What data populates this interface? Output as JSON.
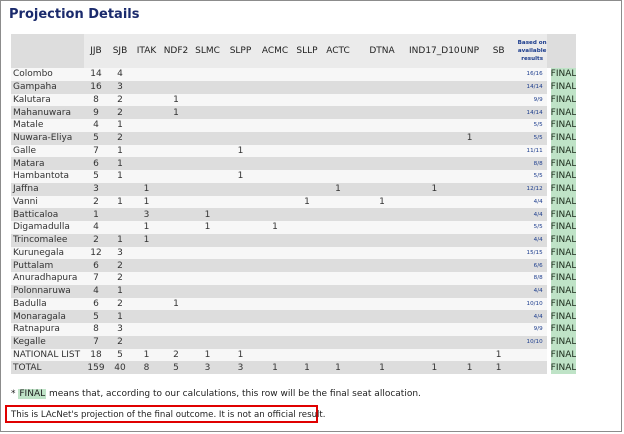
{
  "title": "Projection Details",
  "columns": [
    "JJB",
    "SJB",
    "ITAK",
    "NDF2",
    "SLMC",
    "SLPP",
    "ACMC",
    "SLLP",
    "ACTC",
    "DTNA",
    "IND17_D10",
    "UNP",
    "SB"
  ],
  "based_header": "Based on available results",
  "final_label": "FINAL",
  "rows": [
    {
      "name": "Colombo",
      "cells": [
        "14",
        "4",
        "",
        "",
        "",
        "",
        "",
        "",
        "",
        "",
        "",
        "",
        ""
      ],
      "based": "16/16"
    },
    {
      "name": "Gampaha",
      "cells": [
        "16",
        "3",
        "",
        "",
        "",
        "",
        "",
        "",
        "",
        "",
        "",
        "",
        ""
      ],
      "based": "14/14"
    },
    {
      "name": "Kalutara",
      "cells": [
        "8",
        "2",
        "",
        "1",
        "",
        "",
        "",
        "",
        "",
        "",
        "",
        "",
        ""
      ],
      "based": "9/9"
    },
    {
      "name": "Mahanuwara",
      "cells": [
        "9",
        "2",
        "",
        "1",
        "",
        "",
        "",
        "",
        "",
        "",
        "",
        "",
        ""
      ],
      "based": "14/14"
    },
    {
      "name": "Matale",
      "cells": [
        "4",
        "1",
        "",
        "",
        "",
        "",
        "",
        "",
        "",
        "",
        "",
        "",
        ""
      ],
      "based": "5/5"
    },
    {
      "name": "Nuwara-Eliya",
      "cells": [
        "5",
        "2",
        "",
        "",
        "",
        "",
        "",
        "",
        "",
        "",
        "",
        "1",
        ""
      ],
      "based": "5/5"
    },
    {
      "name": "Galle",
      "cells": [
        "7",
        "1",
        "",
        "",
        "",
        "1",
        "",
        "",
        "",
        "",
        "",
        "",
        ""
      ],
      "based": "11/11"
    },
    {
      "name": "Matara",
      "cells": [
        "6",
        "1",
        "",
        "",
        "",
        "",
        "",
        "",
        "",
        "",
        "",
        "",
        ""
      ],
      "based": "8/8"
    },
    {
      "name": "Hambantota",
      "cells": [
        "5",
        "1",
        "",
        "",
        "",
        "1",
        "",
        "",
        "",
        "",
        "",
        "",
        ""
      ],
      "based": "5/5"
    },
    {
      "name": "Jaffna",
      "cells": [
        "3",
        "",
        "1",
        "",
        "",
        "",
        "",
        "",
        "1",
        "",
        "1",
        "",
        ""
      ],
      "based": "12/12"
    },
    {
      "name": "Vanni",
      "cells": [
        "2",
        "1",
        "1",
        "",
        "",
        "",
        "",
        "1",
        "",
        "1",
        "",
        "",
        ""
      ],
      "based": "4/4"
    },
    {
      "name": "Batticaloa",
      "cells": [
        "1",
        "",
        "3",
        "",
        "1",
        "",
        "",
        "",
        "",
        "",
        "",
        "",
        ""
      ],
      "based": "4/4"
    },
    {
      "name": "Digamadulla",
      "cells": [
        "4",
        "",
        "1",
        "",
        "1",
        "",
        "1",
        "",
        "",
        "",
        "",
        "",
        ""
      ],
      "based": "5/5"
    },
    {
      "name": "Trincomalee",
      "cells": [
        "2",
        "1",
        "1",
        "",
        "",
        "",
        "",
        "",
        "",
        "",
        "",
        "",
        ""
      ],
      "based": "4/4"
    },
    {
      "name": "Kurunegala",
      "cells": [
        "12",
        "3",
        "",
        "",
        "",
        "",
        "",
        "",
        "",
        "",
        "",
        "",
        ""
      ],
      "based": "15/15"
    },
    {
      "name": "Puttalam",
      "cells": [
        "6",
        "2",
        "",
        "",
        "",
        "",
        "",
        "",
        "",
        "",
        "",
        "",
        ""
      ],
      "based": "6/6"
    },
    {
      "name": "Anuradhapura",
      "cells": [
        "7",
        "2",
        "",
        "",
        "",
        "",
        "",
        "",
        "",
        "",
        "",
        "",
        ""
      ],
      "based": "8/8"
    },
    {
      "name": "Polonnaruwa",
      "cells": [
        "4",
        "1",
        "",
        "",
        "",
        "",
        "",
        "",
        "",
        "",
        "",
        "",
        ""
      ],
      "based": "4/4"
    },
    {
      "name": "Badulla",
      "cells": [
        "6",
        "2",
        "",
        "1",
        "",
        "",
        "",
        "",
        "",
        "",
        "",
        "",
        ""
      ],
      "based": "10/10"
    },
    {
      "name": "Monaragala",
      "cells": [
        "5",
        "1",
        "",
        "",
        "",
        "",
        "",
        "",
        "",
        "",
        "",
        "",
        ""
      ],
      "based": "4/4"
    },
    {
      "name": "Ratnapura",
      "cells": [
        "8",
        "3",
        "",
        "",
        "",
        "",
        "",
        "",
        "",
        "",
        "",
        "",
        ""
      ],
      "based": "9/9"
    },
    {
      "name": "Kegalle",
      "cells": [
        "7",
        "2",
        "",
        "",
        "",
        "",
        "",
        "",
        "",
        "",
        "",
        "",
        ""
      ],
      "based": "10/10"
    },
    {
      "name": "NATIONAL LIST",
      "cells": [
        "18",
        "5",
        "1",
        "2",
        "1",
        "1",
        "",
        "",
        "",
        "",
        "",
        "",
        "1"
      ],
      "based": ""
    },
    {
      "name": "TOTAL",
      "cells": [
        "159",
        "40",
        "8",
        "5",
        "3",
        "3",
        "1",
        "1",
        "1",
        "1",
        "1",
        "1",
        "1"
      ],
      "based": ""
    }
  ],
  "footnote": {
    "prefix": "* ",
    "highlight": "FINAL",
    "suffix": " means that, according to our calculations, this row will be the final seat allocation."
  },
  "disclaimer": "This is LAcNet's projection of the final outcome. It is not an official result."
}
